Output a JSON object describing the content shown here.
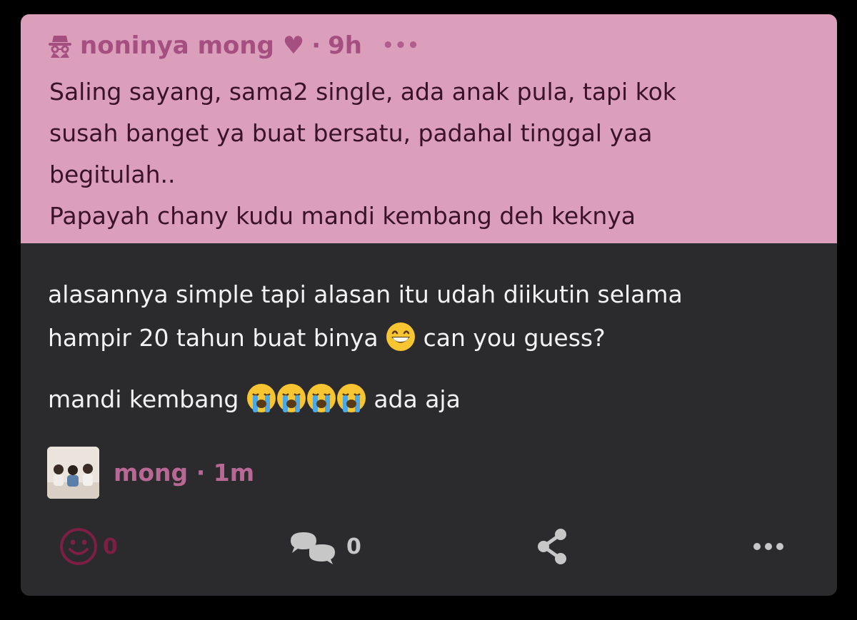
{
  "quoted_post": {
    "author": "noninya mong ♥",
    "separator": "·",
    "time": "9h",
    "more_label": "•••",
    "lines": [
      "Saling sayang, sama2 single, ada anak pula, tapi kok",
      "susah banget ya buat bersatu, padahal tinggal yaa",
      "begitulah..",
      "Papayah chany kudu mandi kembang deh keknya"
    ]
  },
  "post": {
    "line1": "alasannya simple tapi alasan itu udah diikutin selama",
    "line2_before": "hampir 20 tahun buat binya",
    "line2_after": "can you guess?",
    "line3_before": "mandi kembang",
    "line3_after": "ada aja",
    "emoji_grin": "grinning-face-emoji",
    "emoji_cry": "loudly-crying-face-emoji"
  },
  "author": {
    "name": "mong",
    "separator": "·",
    "time": "1m"
  },
  "actions": {
    "reaction_count": "0",
    "comment_count": "0",
    "more_label": "•••"
  },
  "colors": {
    "quote_bg": "#dc9fbb",
    "card_bg": "#2b2a2d",
    "accent_pink": "#b76894",
    "reaction_color": "#7b1f44"
  },
  "icons": [
    "spy-icon",
    "smiley-reaction-icon",
    "comment-bubbles-icon",
    "share-icon",
    "more-options-icon"
  ]
}
